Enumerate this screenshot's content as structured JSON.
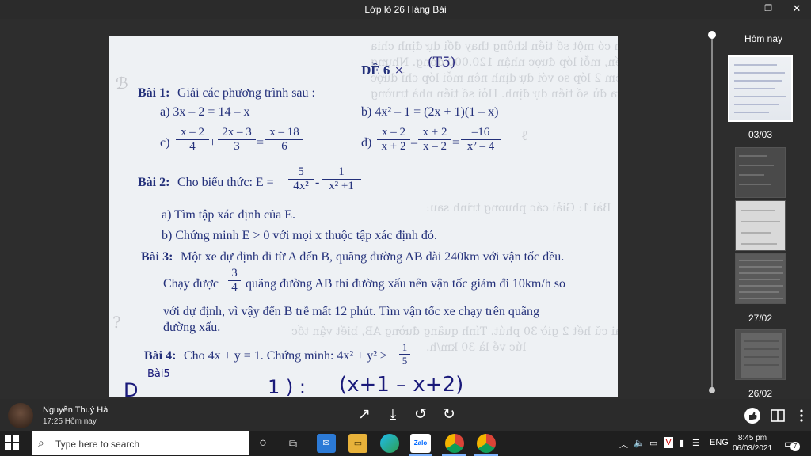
{
  "window": {
    "title": "Lớp lò 26 Hàng Bài",
    "controls": {
      "minimize": "—",
      "maximize": "❐",
      "close": "✕"
    }
  },
  "document": {
    "header": "ĐỀ 6",
    "header_note": "(T5)",
    "bai1": {
      "title": "Bài 1:",
      "prompt": "Giải các phương trình sau :",
      "a": "a) 3x – 2 = 14 – x",
      "b": "b) 4x² – 1 = (2x + 1)(1 – x)",
      "c_label": "c)",
      "c_fracs": [
        {
          "num": "x – 2",
          "den": "4"
        },
        {
          "num": "2x – 3",
          "den": "3"
        },
        {
          "num": "x – 18",
          "den": "6"
        }
      ],
      "d_label": "d)",
      "d_fracs": [
        {
          "num": "x – 2",
          "den": "x + 2"
        },
        {
          "num": "x + 2",
          "den": "x – 2"
        },
        {
          "num": "–16",
          "den": "x² – 4"
        }
      ]
    },
    "bai2": {
      "title": "Bài 2:",
      "prompt": "Cho biểu thức: E =",
      "fracs": [
        {
          "num": "5",
          "den": "4x²"
        },
        {
          "num": "1",
          "den": "x² +1"
        }
      ],
      "a": "a) Tìm tập xác định của E.",
      "b": "b) Chứng minh  E > 0 với mọi x thuộc tập xác định đó."
    },
    "bai3": {
      "title": "Bài 3:",
      "line1": "Một xe dự định đi từ A đến B, quãng đường AB dài 240km với vận tốc đều.",
      "line2_pre": "Chạy được",
      "frac": {
        "num": "3",
        "den": "4"
      },
      "line2_post": "quãng đường AB thì đường xấu nên vận tốc giảm đi 10km/h so",
      "line3": "với dự định, vì vậy đến  B trễ mất 12 phút. Tìm vận tốc xe chạy trên quãng",
      "line4": "đường xấu."
    },
    "bai4": {
      "title": "Bài 4:",
      "text": "Cho 4x + y = 1. Chứng minh: 4x² + y² ≥",
      "frac": {
        "num": "1",
        "den": "5"
      }
    },
    "handwriting": {
      "top_note": "Bài5",
      "bottom": "(x+1   –   x+2)"
    }
  },
  "sidebar": {
    "today_label": "Hôm nay",
    "dates": [
      "03/03",
      "27/02",
      "26/02"
    ]
  },
  "sender": {
    "name": "Nguyễn Thuý Hà",
    "time": "17:25 Hôm nay"
  },
  "toolbar": {
    "share": "↗",
    "download": "⤓",
    "rotate_left": "↺",
    "rotate_right": "↻"
  },
  "taskbar": {
    "search_placeholder": "Type here to search",
    "lang": "ENG",
    "time": "8:45 pm",
    "date": "06/03/2021",
    "notif_count": "7",
    "zalo_label": "Zalo"
  }
}
